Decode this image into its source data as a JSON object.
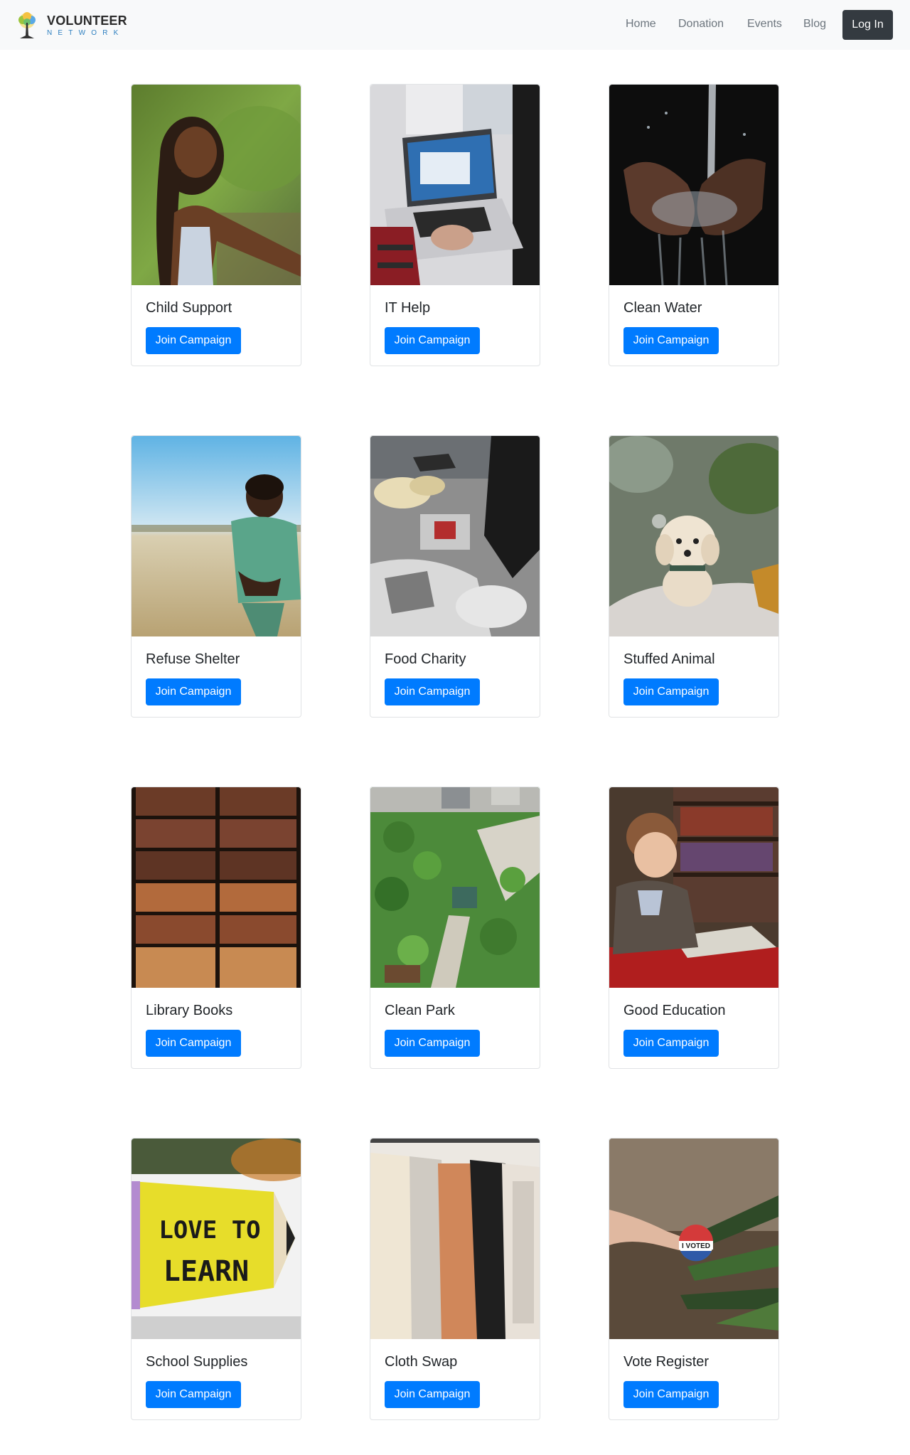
{
  "nav": {
    "brand_name": "VOLUNTEER",
    "brand_sub": "NETWORK",
    "links": [
      "Home",
      "Donation",
      "Events",
      "Blog"
    ],
    "login_label": "Log In"
  },
  "campaigns": [
    {
      "title": "Child Support",
      "button": "Join Campaign",
      "image": "girl-outdoors-photo"
    },
    {
      "title": "IT Help",
      "button": "Join Campaign",
      "image": "laptop-typing-photo"
    },
    {
      "title": "Clean Water",
      "button": "Join Campaign",
      "image": "hands-water-photo"
    },
    {
      "title": "Refuse Shelter",
      "button": "Join Campaign",
      "image": "boy-in-field-photo"
    },
    {
      "title": "Food Charity",
      "button": "Join Campaign",
      "image": "food-sorting-photo"
    },
    {
      "title": "Stuffed Animal",
      "button": "Join Campaign",
      "image": "small-dog-photo"
    },
    {
      "title": "Library Books",
      "button": "Join Campaign",
      "image": "bookshelves-photo"
    },
    {
      "title": "Clean Park",
      "button": "Join Campaign",
      "image": "aerial-park-photo"
    },
    {
      "title": "Good Education",
      "button": "Join Campaign",
      "image": "child-reading-photo"
    },
    {
      "title": "School Supplies",
      "button": "Join Campaign",
      "image": "love-to-learn-pencil-photo"
    },
    {
      "title": "Cloth Swap",
      "button": "Join Campaign",
      "image": "clothing-rack-photo"
    },
    {
      "title": "Vote Register",
      "button": "Join Campaign",
      "image": "i-voted-sticker-photo"
    }
  ],
  "image_text": {
    "pencil_line1": "LOVE TO",
    "pencil_line2": "LEARN",
    "sticker": "I VOTED"
  }
}
